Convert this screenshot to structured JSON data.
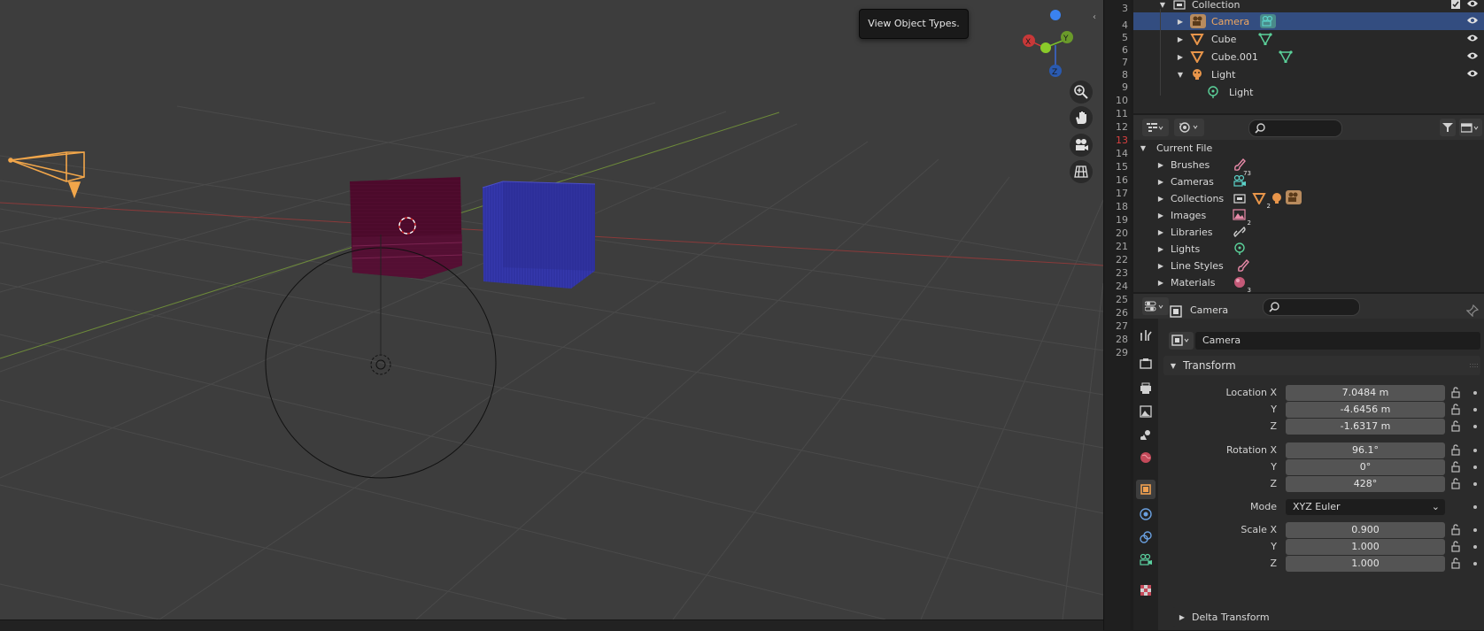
{
  "viewport": {
    "tooltip": "View Object Types.",
    "gizmo": {
      "x_label": "X",
      "y_label": "Y",
      "z_label": "Z"
    }
  },
  "text_editor": {
    "line_numbers": [
      "3",
      "4",
      "5",
      "6",
      "7",
      "8",
      "9",
      "10",
      "11",
      "12",
      "13",
      "14",
      "15",
      "16",
      "17",
      "18",
      "19",
      "20",
      "21",
      "22",
      "23",
      "24",
      "25",
      "26",
      "27",
      "28",
      "29"
    ],
    "highlighted_line": "13"
  },
  "outliner": {
    "rows": [
      {
        "label": "Collection",
        "icon": "collection-icon",
        "expanded": true
      },
      {
        "label": "Camera",
        "icon": "camera-object-icon",
        "selected": true,
        "data_icon": "camera-data-icon"
      },
      {
        "label": "Cube",
        "icon": "mesh-object-icon",
        "data_icon": "mesh-data-icon"
      },
      {
        "label": "Cube.001",
        "icon": "mesh-object-icon",
        "data_icon": "mesh-data-icon"
      },
      {
        "label": "Light",
        "icon": "light-object-icon",
        "expanded": true
      },
      {
        "label": "Light",
        "icon": "light-data-icon"
      }
    ]
  },
  "blend_file": {
    "root": "Current File",
    "items": [
      {
        "label": "Brushes",
        "count": "73",
        "icon": "brush-icon"
      },
      {
        "label": "Cameras",
        "icon": "camera-data-icon"
      },
      {
        "label": "Collections",
        "icon": "collection-icon",
        "count": "2"
      },
      {
        "label": "Images",
        "count": "2",
        "icon": "image-icon"
      },
      {
        "label": "Libraries",
        "icon": "link-icon"
      },
      {
        "label": "Lights",
        "icon": "light-data-icon"
      },
      {
        "label": "Line Styles",
        "icon": "line-style-icon"
      },
      {
        "label": "Materials",
        "count": "3",
        "icon": "material-icon"
      }
    ]
  },
  "properties": {
    "object_name": "Camera",
    "name_field": "Camera",
    "transform_label": "Transform",
    "location_label": "Location X",
    "rotation_label": "Rotation X",
    "scale_label": "Scale X",
    "axis_y": "Y",
    "axis_z": "Z",
    "location": [
      "7.0484 m",
      "-4.6456 m",
      "-1.6317 m"
    ],
    "rotation": [
      "96.1°",
      "0°",
      "428°"
    ],
    "mode_label": "Mode",
    "mode_value": "XYZ Euler",
    "scale": [
      "0.900",
      "1.000",
      "1.000"
    ],
    "delta_transform": "Delta Transform"
  },
  "colors": {
    "selection": "#334d80",
    "object_orange": "#e8954a",
    "data_green": "#5bd19a",
    "cube_red": "#4b0a2a",
    "cube_blue": "#2e2f9e"
  }
}
